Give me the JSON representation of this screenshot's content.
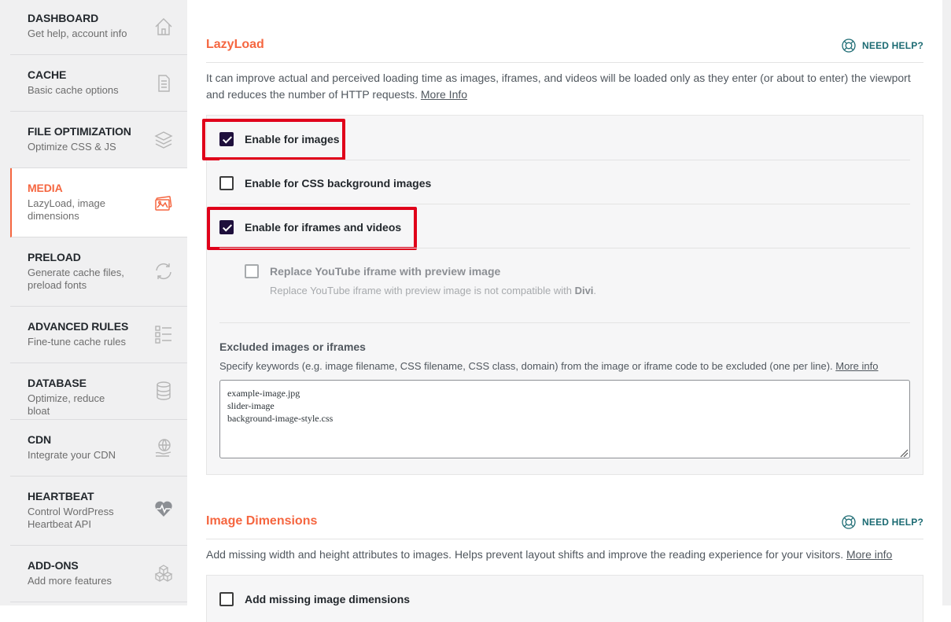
{
  "sidebar": {
    "items": [
      {
        "title": "DASHBOARD",
        "desc": "Get help, account info",
        "icon": "home-icon",
        "active": false
      },
      {
        "title": "CACHE",
        "desc": "Basic cache options",
        "icon": "document-icon",
        "active": false
      },
      {
        "title": "FILE OPTIMIZATION",
        "desc": "Optimize CSS & JS",
        "icon": "layers-icon",
        "active": false
      },
      {
        "title": "MEDIA",
        "desc": "LazyLoad, image dimensions",
        "icon": "images-icon",
        "active": true
      },
      {
        "title": "PRELOAD",
        "desc": "Generate cache files, preload fonts",
        "icon": "refresh-icon",
        "active": false
      },
      {
        "title": "ADVANCED RULES",
        "desc": "Fine-tune cache rules",
        "icon": "checklist-icon",
        "active": false
      },
      {
        "title": "DATABASE",
        "desc": "Optimize, reduce bloat",
        "icon": "database-icon",
        "active": false
      },
      {
        "title": "CDN",
        "desc": "Integrate your CDN",
        "icon": "globe-hand-icon",
        "active": false
      },
      {
        "title": "HEARTBEAT",
        "desc": "Control WordPress Heartbeat API",
        "icon": "heartbeat-icon",
        "active": false
      },
      {
        "title": "ADD-ONS",
        "desc": "Add more features",
        "icon": "cubes-icon",
        "active": false
      }
    ]
  },
  "lazyload": {
    "title": "LazyLoad",
    "help": "NEED HELP?",
    "intro": "It can improve actual and perceived loading time as images, iframes, and videos will be loaded only as they enter (or about to enter) the viewport and reduces the number of HTTP requests.",
    "intro_link": "More Info",
    "options": [
      {
        "label": "Enable for images",
        "checked": true
      },
      {
        "label": "Enable for CSS background images",
        "checked": false
      },
      {
        "label": "Enable for iframes and videos",
        "checked": true
      }
    ],
    "youtube": {
      "label": "Replace YouTube iframe with preview image",
      "checked": false,
      "note_prefix": "Replace YouTube iframe with preview image is not compatible with",
      "note_strong": "Divi",
      "note_suffix": "."
    },
    "excluded": {
      "label": "Excluded images or iframes",
      "desc": "Specify keywords (e.g. image filename, CSS filename, CSS class, domain) from the image or iframe code to be excluded (one per line).",
      "desc_link": "More info",
      "value": "example-image.jpg\nslider-image\nbackground-image-style.css"
    }
  },
  "image_dimensions": {
    "title": "Image Dimensions",
    "help": "NEED HELP?",
    "intro": "Add missing width and height attributes to images. Helps prevent layout shifts and improve the reading experience for your visitors.",
    "intro_link": "More info",
    "option": {
      "label": "Add missing image dimensions",
      "checked": false
    }
  },
  "colors": {
    "accent": "#f56640",
    "help": "#1c6b73",
    "checkbox": "#1e0f3c",
    "highlight": "#e0001a"
  }
}
